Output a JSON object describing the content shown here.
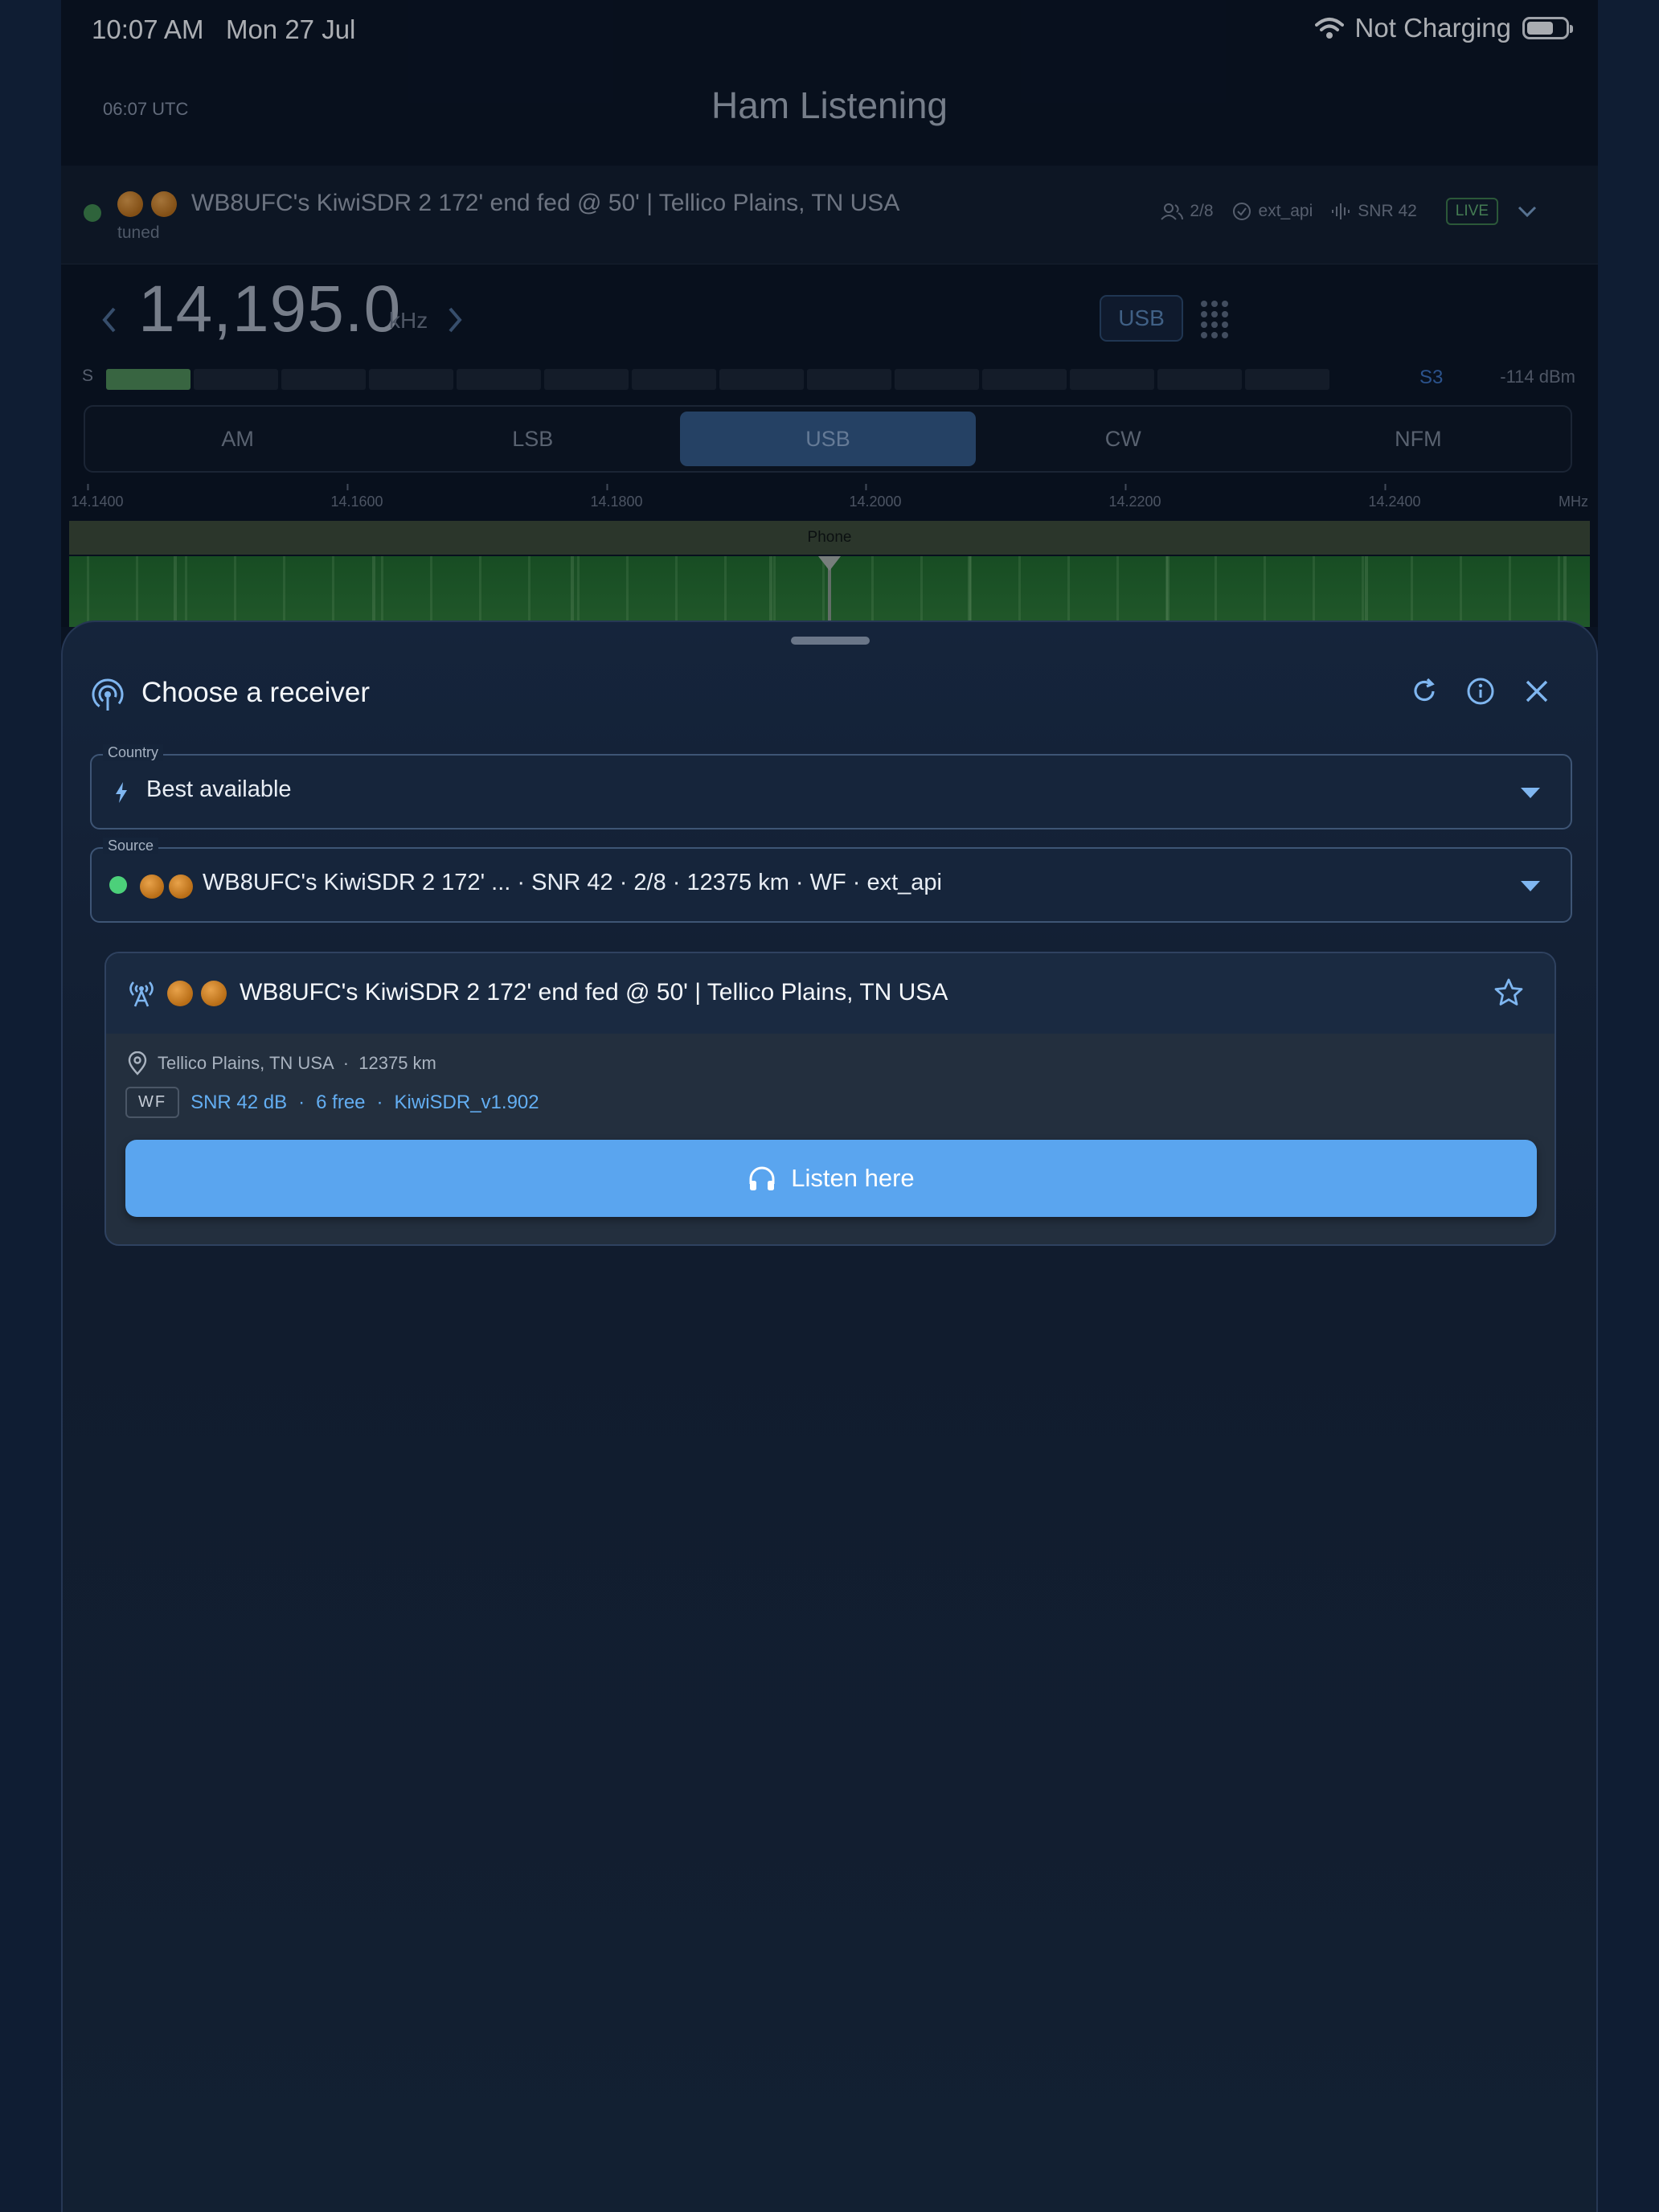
{
  "status_bar": {
    "time": "10:07 AM",
    "date": "Mon 27 Jul",
    "charging": "Not Charging"
  },
  "header": {
    "utc": "06:07 UTC",
    "title": "Ham Listening"
  },
  "receiver_bar": {
    "name": "WB8UFC's KiwiSDR 2 172' end fed @ 50' | Tellico Plains, TN USA",
    "state": "tuned",
    "users": "2/8",
    "api": "ext_api",
    "snr": "SNR 42",
    "live": "LIVE"
  },
  "tuner": {
    "frequency": "14,195.0",
    "unit": "kHz",
    "mode_chip": "USB",
    "smeter_label": "S",
    "s_value": "S3",
    "dbm": "-114 dBm",
    "smeter_level_segments": 1,
    "smeter_total_segments": 14
  },
  "modes": [
    {
      "label": "AM",
      "active": false
    },
    {
      "label": "LSB",
      "active": false
    },
    {
      "label": "USB",
      "active": true
    },
    {
      "label": "CW",
      "active": false
    },
    {
      "label": "NFM",
      "active": false
    }
  ],
  "axis": {
    "ticks": [
      "14.1400",
      "14.1600",
      "14.1800",
      "14.2000",
      "14.2200",
      "14.2400"
    ],
    "unit": "MHz",
    "band_label": "Phone"
  },
  "sheet": {
    "title": "Choose a receiver",
    "country": {
      "label": "Country",
      "value": "Best available"
    },
    "source": {
      "label": "Source",
      "value": "WB8UFC's KiwiSDR 2 172' ... · SNR 42 · 2/8 · 12375 km · WF · ext_api"
    },
    "card": {
      "title": "WB8UFC's KiwiSDR 2 172' end fed @ 50' | Tellico Plains, TN USA",
      "location": "Tellico Plains, TN USA",
      "distance": "12375 km",
      "wf": "WF",
      "snr": "SNR 42 dB",
      "free": "6 free",
      "version": "KiwiSDR_v1.902",
      "listen": "Listen here"
    }
  },
  "colors": {
    "accent": "#5aa5ef",
    "online": "#4cd07a",
    "live": "#5fae6f",
    "sheet_bg": "#15243b"
  }
}
